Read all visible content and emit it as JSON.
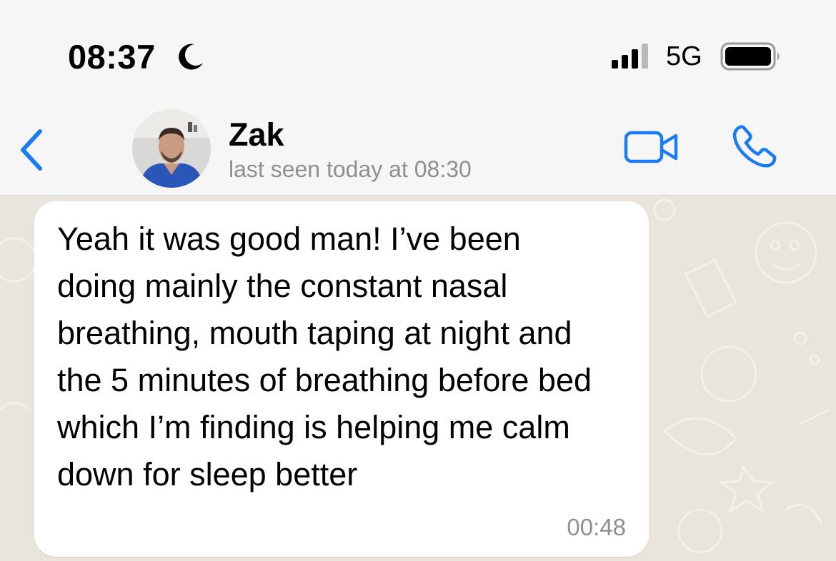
{
  "status_bar": {
    "time": "08:37",
    "focus_icon": "moon-icon",
    "signal_icon": "cellular-signal-icon",
    "network": "5G",
    "battery_icon": "battery-icon"
  },
  "header": {
    "back_icon": "chevron-left-icon",
    "contact_name": "Zak",
    "last_seen": "last seen today at 08:30",
    "video_call_icon": "video-camera-icon",
    "voice_call_icon": "phone-icon",
    "accent_color": "#1a7cf5"
  },
  "messages": [
    {
      "direction": "incoming",
      "text": "Yeah it was good man! I’ve been doing mainly the constant nasal breathing, mouth taping at night and the 5 minutes of breathing before bed which I’m finding is helping me calm down for sleep better",
      "time": "00:48"
    }
  ],
  "colors": {
    "wallpaper": "#e9e4dc",
    "bubble": "#ffffff",
    "secondary_text": "#8e8e93"
  }
}
